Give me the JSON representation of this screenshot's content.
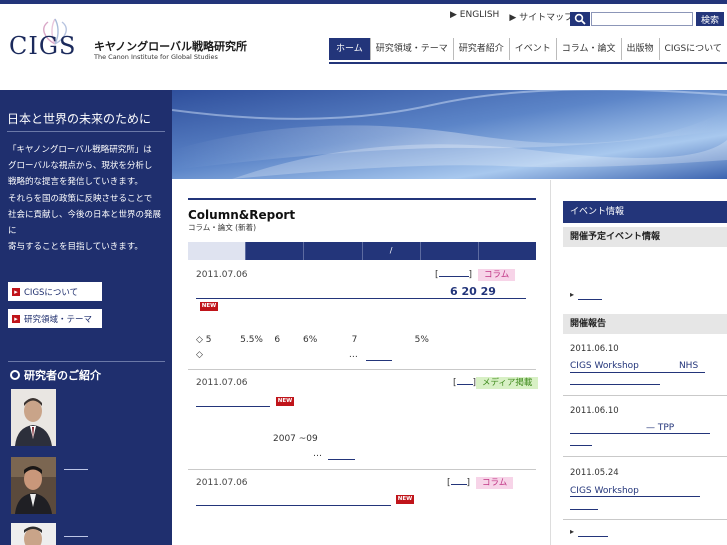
{
  "header": {
    "logo_text": "CIGS",
    "org_name_jp": "キヤノングローバル戦略研究所",
    "org_name_en": "The Canon Institute for Global Studies",
    "util_links": [
      "▶ ENGLISH",
      "▶ サイトマップ"
    ],
    "search_placeholder": "",
    "search_button": "検索"
  },
  "nav": {
    "items": [
      "ホーム",
      "研究領域・テーマ",
      "研究者紹介",
      "イベント",
      "コラム・論文",
      "出版物",
      "CIGSについて"
    ],
    "active_index": 0
  },
  "sidebar": {
    "tagline": "日本と世界の未来のために",
    "intro_lines": [
      "「キヤノングローバル戦略研究所」は",
      "グローバルな視点から、現状を分析し",
      "戦略的な提言を発信していきます。",
      "それらを国の政策に反映させることで",
      "社会に貢献し、今後の日本と世界の発展に",
      "寄与することを目指していきます。"
    ],
    "buttons": [
      "CIGSについて",
      "研究領域・テーマ"
    ],
    "researchers_heading": "研究者のご紹介"
  },
  "column_report": {
    "title": "Column&Report",
    "subtitle": "コラム・論文 (新着)",
    "tabs": [
      "",
      "",
      "",
      "/",
      "",
      ""
    ],
    "entries": [
      {
        "date": "2011.07.06",
        "category": "コラム",
        "headline_numbers": "6   20   29",
        "new": "NEW",
        "body_1": "◇ 5          5.5%    6        6%            7                    5%",
        "body_2": "◇                                                   …"
      },
      {
        "date": "2011.07.06",
        "category": "メディア掲載",
        "new": "NEW",
        "body_1": "2007 ~09",
        "body_2": "…"
      },
      {
        "date": "2011.07.06",
        "category": "コラム",
        "new": "NEW"
      }
    ]
  },
  "events": {
    "title": "イベント情報",
    "upcoming_heading": "開催予定イベント情報",
    "more": "▸",
    "report_heading": "開催報告",
    "reports": [
      {
        "date": "2011.06.10",
        "title": "CIGS Workshop              NHS"
      },
      {
        "date": "2011.06.10",
        "title": "— TPP"
      },
      {
        "date": "2011.05.24",
        "title": "CIGS Workshop"
      }
    ]
  },
  "colors": {
    "brand_navy": "#23357a",
    "new_red": "#c0141a",
    "column_pink": "#f7d4e8",
    "media_green": "#d8f0c5"
  }
}
